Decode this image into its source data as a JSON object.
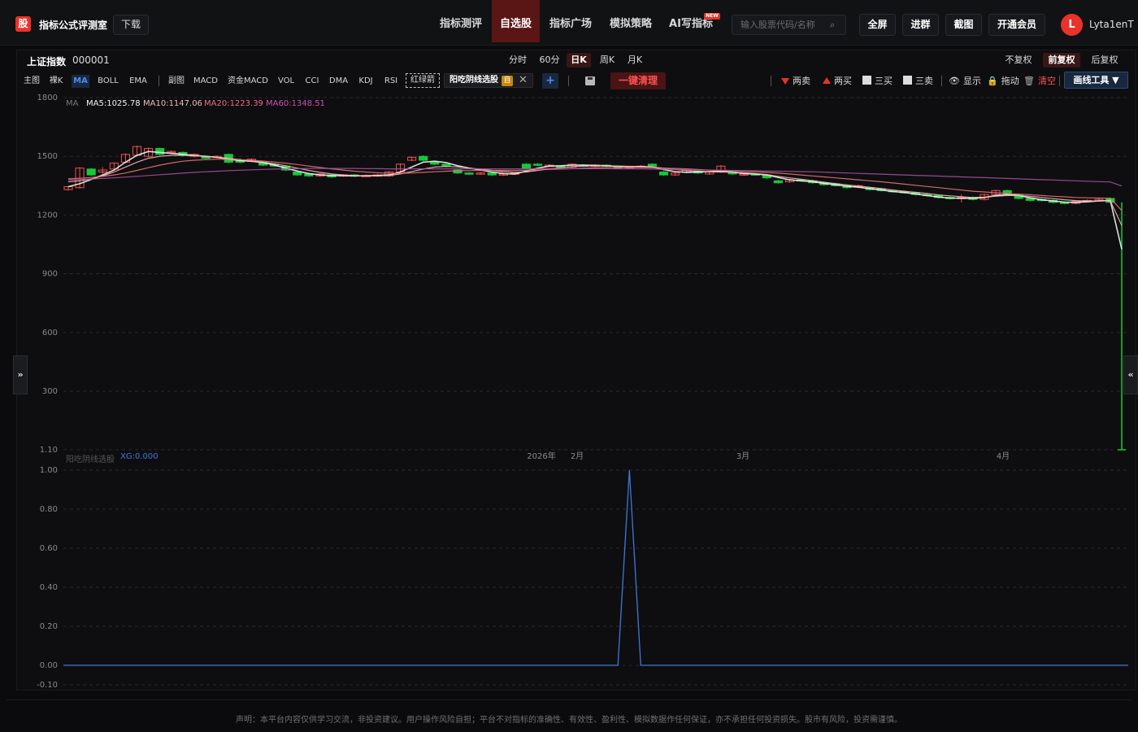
{
  "header": {
    "logo_glyph": "股",
    "app_title": "指标公式评测室",
    "download_label": "下载",
    "nav": [
      {
        "label": "指标测评"
      },
      {
        "label": "自选股"
      },
      {
        "label": "指标广场"
      },
      {
        "label": "模拟策略"
      },
      {
        "label": "AI写指标"
      }
    ],
    "new_badge": "NEW",
    "search_placeholder": "输入股票代码/名称",
    "buttons": {
      "fullscreen": "全屏",
      "join_group": "进群",
      "screenshot": "截图",
      "membership": "开通会员"
    },
    "avatar_letter": "L",
    "username": "Lyta1enT"
  },
  "stock": {
    "name": "上证指数",
    "code": "000001"
  },
  "periods": [
    "分时",
    "60分",
    "日K",
    "周K",
    "月K"
  ],
  "active_period": "日K",
  "adjustments": [
    "不复权",
    "前复权",
    "后复权"
  ],
  "active_adjustment": "前复权",
  "indicators": {
    "main": [
      "主图",
      "裸K",
      "MA",
      "BOLL",
      "EMA"
    ],
    "sub": [
      "副图",
      "MACD",
      "资金MACD",
      "VOL",
      "CCI",
      "DMA",
      "KDJ",
      "RSI"
    ],
    "red_green_arrow": "红绿箭",
    "custom_chip": "阳吃阴线选股",
    "custom_chip_tag": "自",
    "clear_all": "一键清理"
  },
  "tools": {
    "two_sell": "两卖",
    "two_buy": "两买",
    "three_buy": "三买",
    "three_sell": "三卖",
    "show": "显示",
    "drag": "拖动",
    "clear": "清空",
    "draw_tools": "画线工具 ▼"
  },
  "colors": {
    "accent_red": "#e8322b",
    "up_candle": "#ef4f4f",
    "down_candle": "#16c93a",
    "ma5": "#f2f2f2",
    "ma10": "#f3b7b7",
    "ma20": "#e57373",
    "ma60": "#a4519c",
    "sub_line": "#3d78d8"
  },
  "chart_data": {
    "type": "candlestick",
    "main": {
      "ma_legend": {
        "label": "MA",
        "ma5": "MA5:1025.78",
        "ma10": "MA10:1147.06",
        "ma20": "MA20:1223.39",
        "ma60": "MA60:1348.51"
      },
      "y_ticks": [
        "1800",
        "1500",
        "1200",
        "900",
        "600",
        "300",
        "1.10"
      ],
      "y_values": [
        1800,
        1500,
        1200,
        900,
        600,
        300,
        1.1
      ],
      "ylim": [
        1.1,
        1800
      ],
      "x_labels": [
        "2026年",
        "2月",
        "3月",
        "4月"
      ],
      "candles": [
        {
          "o": 1330,
          "c": 1345,
          "h": 1348,
          "l": 1325
        },
        {
          "o": 1340,
          "c": 1440,
          "h": 1445,
          "l": 1335
        },
        {
          "o": 1435,
          "c": 1405,
          "h": 1440,
          "l": 1400
        },
        {
          "o": 1420,
          "c": 1430,
          "h": 1445,
          "l": 1410
        },
        {
          "o": 1435,
          "c": 1465,
          "h": 1470,
          "l": 1430
        },
        {
          "o": 1470,
          "c": 1510,
          "h": 1515,
          "l": 1465
        },
        {
          "o": 1505,
          "c": 1550,
          "h": 1555,
          "l": 1500
        },
        {
          "o": 1500,
          "c": 1540,
          "h": 1545,
          "l": 1495
        },
        {
          "o": 1540,
          "c": 1510,
          "h": 1545,
          "l": 1505
        },
        {
          "o": 1520,
          "c": 1525,
          "h": 1530,
          "l": 1512
        },
        {
          "o": 1520,
          "c": 1505,
          "h": 1525,
          "l": 1500
        },
        {
          "o": 1500,
          "c": 1510,
          "h": 1515,
          "l": 1495
        },
        {
          "o": 1500,
          "c": 1490,
          "h": 1505,
          "l": 1485
        },
        {
          "o": 1495,
          "c": 1500,
          "h": 1505,
          "l": 1490
        },
        {
          "o": 1510,
          "c": 1470,
          "h": 1515,
          "l": 1465
        },
        {
          "o": 1480,
          "c": 1470,
          "h": 1490,
          "l": 1465
        },
        {
          "o": 1475,
          "c": 1485,
          "h": 1490,
          "l": 1470
        },
        {
          "o": 1470,
          "c": 1455,
          "h": 1475,
          "l": 1450
        },
        {
          "o": 1460,
          "c": 1450,
          "h": 1465,
          "l": 1445
        },
        {
          "o": 1450,
          "c": 1430,
          "h": 1455,
          "l": 1425
        },
        {
          "o": 1420,
          "c": 1405,
          "h": 1425,
          "l": 1400
        },
        {
          "o": 1410,
          "c": 1400,
          "h": 1415,
          "l": 1395
        },
        {
          "o": 1400,
          "c": 1410,
          "h": 1415,
          "l": 1395
        },
        {
          "o": 1405,
          "c": 1395,
          "h": 1410,
          "l": 1390
        },
        {
          "o": 1400,
          "c": 1405,
          "h": 1410,
          "l": 1395
        },
        {
          "o": 1405,
          "c": 1400,
          "h": 1410,
          "l": 1395
        },
        {
          "o": 1400,
          "c": 1402,
          "h": 1407,
          "l": 1395
        },
        {
          "o": 1400,
          "c": 1405,
          "h": 1410,
          "l": 1395
        },
        {
          "o": 1400,
          "c": 1420,
          "h": 1425,
          "l": 1395
        },
        {
          "o": 1420,
          "c": 1460,
          "h": 1465,
          "l": 1415
        },
        {
          "o": 1480,
          "c": 1495,
          "h": 1500,
          "l": 1475
        },
        {
          "o": 1500,
          "c": 1480,
          "h": 1505,
          "l": 1475
        },
        {
          "o": 1470,
          "c": 1460,
          "h": 1475,
          "l": 1455
        },
        {
          "o": 1460,
          "c": 1450,
          "h": 1465,
          "l": 1445
        },
        {
          "o": 1430,
          "c": 1415,
          "h": 1435,
          "l": 1410
        },
        {
          "o": 1415,
          "c": 1410,
          "h": 1420,
          "l": 1405
        },
        {
          "o": 1410,
          "c": 1415,
          "h": 1420,
          "l": 1405
        },
        {
          "o": 1415,
          "c": 1405,
          "h": 1420,
          "l": 1400
        },
        {
          "o": 1405,
          "c": 1410,
          "h": 1415,
          "l": 1400
        },
        {
          "o": 1410,
          "c": 1415,
          "h": 1420,
          "l": 1405
        },
        {
          "o": 1460,
          "c": 1440,
          "h": 1465,
          "l": 1435
        },
        {
          "o": 1460,
          "c": 1455,
          "h": 1465,
          "l": 1450
        },
        {
          "o": 1450,
          "c": 1455,
          "h": 1460,
          "l": 1445
        },
        {
          "o": 1450,
          "c": 1445,
          "h": 1455,
          "l": 1440
        },
        {
          "o": 1445,
          "c": 1460,
          "h": 1465,
          "l": 1440
        },
        {
          "o": 1455,
          "c": 1450,
          "h": 1460,
          "l": 1445
        },
        {
          "o": 1450,
          "c": 1455,
          "h": 1460,
          "l": 1445
        },
        {
          "o": 1455,
          "c": 1450,
          "h": 1460,
          "l": 1445
        },
        {
          "o": 1445,
          "c": 1440,
          "h": 1450,
          "l": 1435
        },
        {
          "o": 1440,
          "c": 1445,
          "h": 1450,
          "l": 1435
        },
        {
          "o": 1445,
          "c": 1450,
          "h": 1455,
          "l": 1440
        },
        {
          "o": 1460,
          "c": 1450,
          "h": 1465,
          "l": 1445
        },
        {
          "o": 1420,
          "c": 1405,
          "h": 1425,
          "l": 1400
        },
        {
          "o": 1405,
          "c": 1415,
          "h": 1420,
          "l": 1400
        },
        {
          "o": 1420,
          "c": 1430,
          "h": 1435,
          "l": 1415
        },
        {
          "o": 1425,
          "c": 1415,
          "h": 1430,
          "l": 1410
        },
        {
          "o": 1410,
          "c": 1420,
          "h": 1425,
          "l": 1405
        },
        {
          "o": 1420,
          "c": 1450,
          "h": 1455,
          "l": 1415
        },
        {
          "o": 1420,
          "c": 1410,
          "h": 1425,
          "l": 1405
        },
        {
          "o": 1405,
          "c": 1410,
          "h": 1415,
          "l": 1400
        },
        {
          "o": 1410,
          "c": 1405,
          "h": 1415,
          "l": 1400
        },
        {
          "o": 1405,
          "c": 1390,
          "h": 1410,
          "l": 1385
        },
        {
          "o": 1375,
          "c": 1365,
          "h": 1380,
          "l": 1360
        },
        {
          "o": 1370,
          "c": 1380,
          "h": 1385,
          "l": 1365
        },
        {
          "o": 1380,
          "c": 1375,
          "h": 1385,
          "l": 1370
        },
        {
          "o": 1375,
          "c": 1365,
          "h": 1380,
          "l": 1360
        },
        {
          "o": 1365,
          "c": 1355,
          "h": 1370,
          "l": 1350
        },
        {
          "o": 1360,
          "c": 1350,
          "h": 1365,
          "l": 1345
        },
        {
          "o": 1350,
          "c": 1340,
          "h": 1355,
          "l": 1335
        },
        {
          "o": 1345,
          "c": 1350,
          "h": 1355,
          "l": 1340
        },
        {
          "o": 1340,
          "c": 1330,
          "h": 1345,
          "l": 1325
        },
        {
          "o": 1335,
          "c": 1325,
          "h": 1340,
          "l": 1320
        },
        {
          "o": 1325,
          "c": 1320,
          "h": 1330,
          "l": 1315
        },
        {
          "o": 1320,
          "c": 1315,
          "h": 1325,
          "l": 1310
        },
        {
          "o": 1315,
          "c": 1305,
          "h": 1320,
          "l": 1300
        },
        {
          "o": 1305,
          "c": 1300,
          "h": 1310,
          "l": 1295
        },
        {
          "o": 1300,
          "c": 1290,
          "h": 1305,
          "l": 1285
        },
        {
          "o": 1290,
          "c": 1285,
          "h": 1295,
          "l": 1280
        },
        {
          "o": 1285,
          "c": 1290,
          "h": 1305,
          "l": 1265
        },
        {
          "o": 1290,
          "c": 1280,
          "h": 1295,
          "l": 1275
        },
        {
          "o": 1280,
          "c": 1305,
          "h": 1310,
          "l": 1275
        },
        {
          "o": 1305,
          "c": 1325,
          "h": 1330,
          "l": 1300
        },
        {
          "o": 1325,
          "c": 1310,
          "h": 1330,
          "l": 1305
        },
        {
          "o": 1305,
          "c": 1285,
          "h": 1310,
          "l": 1280
        },
        {
          "o": 1285,
          "c": 1275,
          "h": 1290,
          "l": 1270
        },
        {
          "o": 1280,
          "c": 1275,
          "h": 1285,
          "l": 1270
        },
        {
          "o": 1275,
          "c": 1265,
          "h": 1280,
          "l": 1260
        },
        {
          "o": 1265,
          "c": 1260,
          "h": 1270,
          "l": 1255
        },
        {
          "o": 1260,
          "c": 1270,
          "h": 1275,
          "l": 1255
        },
        {
          "o": 1270,
          "c": 1275,
          "h": 1280,
          "l": 1265
        },
        {
          "o": 1275,
          "c": 1280,
          "h": 1285,
          "l": 1270
        },
        {
          "o": 1285,
          "c": 1265,
          "h": 1290,
          "l": 1260
        },
        {
          "o": 1265,
          "c": 1.1,
          "h": 1265,
          "l": 1.1
        }
      ],
      "ma_series": [
        {
          "name": "MA5",
          "values": [
            1345,
            1360,
            1382,
            1405,
            1430,
            1470,
            1505,
            1525,
            1520,
            1515,
            1510,
            1505,
            1500,
            1495,
            1485,
            1478,
            1475,
            1468,
            1455,
            1440,
            1425,
            1412,
            1405,
            1402,
            1401,
            1400,
            1401,
            1402,
            1405,
            1420,
            1445,
            1470,
            1475,
            1468,
            1452,
            1440,
            1430,
            1420,
            1412,
            1410,
            1425,
            1440,
            1450,
            1452,
            1455,
            1455,
            1454,
            1452,
            1449,
            1447,
            1448,
            1445,
            1432,
            1422,
            1418,
            1420,
            1422,
            1425,
            1420,
            1412,
            1410,
            1405,
            1392,
            1380,
            1375,
            1370,
            1362,
            1355,
            1347,
            1342,
            1335,
            1328,
            1320,
            1315,
            1308,
            1300,
            1292,
            1287,
            1286,
            1285,
            1290,
            1300,
            1305,
            1300,
            1288,
            1278,
            1272,
            1266,
            1265,
            1268,
            1272,
            1275,
            1025.78
          ]
        },
        {
          "name": "MA10",
          "values": [
            1370,
            1375,
            1385,
            1400,
            1420,
            1445,
            1470,
            1490,
            1500,
            1505,
            1505,
            1503,
            1500,
            1495,
            1490,
            1483,
            1477,
            1470,
            1462,
            1452,
            1440,
            1428,
            1418,
            1410,
            1405,
            1402,
            1400,
            1400,
            1402,
            1410,
            1422,
            1435,
            1445,
            1448,
            1446,
            1440,
            1435,
            1428,
            1422,
            1418,
            1420,
            1428,
            1436,
            1442,
            1447,
            1450,
            1451,
            1451,
            1450,
            1449,
            1448,
            1446,
            1440,
            1433,
            1427,
            1424,
            1421,
            1420,
            1419,
            1416,
            1412,
            1407,
            1398,
            1390,
            1383,
            1376,
            1368,
            1361,
            1354,
            1348,
            1342,
            1335,
            1328,
            1322,
            1316,
            1310,
            1303,
            1298,
            1294,
            1290,
            1292,
            1296,
            1300,
            1300,
            1296,
            1290,
            1284,
            1278,
            1274,
            1272,
            1272,
            1273,
            1147.06
          ]
        },
        {
          "name": "MA20",
          "values": [
            1385,
            1388,
            1392,
            1398,
            1405,
            1415,
            1428,
            1442,
            1455,
            1466,
            1475,
            1480,
            1483,
            1485,
            1485,
            1483,
            1480,
            1476,
            1471,
            1465,
            1458,
            1450,
            1443,
            1436,
            1430,
            1424,
            1420,
            1416,
            1413,
            1413,
            1415,
            1418,
            1421,
            1424,
            1426,
            1427,
            1428,
            1428,
            1428,
            1428,
            1429,
            1431,
            1433,
            1435,
            1437,
            1439,
            1441,
            1442,
            1443,
            1443,
            1443,
            1442,
            1440,
            1438,
            1436,
            1433,
            1430,
            1428,
            1426,
            1424,
            1421,
            1418,
            1414,
            1410,
            1405,
            1400,
            1395,
            1390,
            1385,
            1380,
            1375,
            1370,
            1364,
            1358,
            1352,
            1346,
            1340,
            1334,
            1328,
            1322,
            1318,
            1314,
            1310,
            1307,
            1304,
            1300,
            1296,
            1293,
            1290,
            1288,
            1287,
            1286,
            1223.39
          ]
        },
        {
          "name": "MA60",
          "values": [
            1380,
            1382,
            1384,
            1387,
            1390,
            1394,
            1398,
            1402,
            1406,
            1410,
            1414,
            1418,
            1421,
            1424,
            1427,
            1429,
            1431,
            1433,
            1435,
            1436,
            1437,
            1438,
            1438,
            1438,
            1438,
            1438,
            1437,
            1437,
            1436,
            1436,
            1436,
            1436,
            1436,
            1436,
            1436,
            1436,
            1436,
            1436,
            1436,
            1436,
            1436,
            1437,
            1437,
            1437,
            1437,
            1437,
            1437,
            1437,
            1436,
            1436,
            1436,
            1435,
            1434,
            1433,
            1432,
            1431,
            1430,
            1429,
            1428,
            1427,
            1426,
            1425,
            1424,
            1423,
            1422,
            1421,
            1419,
            1417,
            1415,
            1413,
            1411,
            1409,
            1407,
            1405,
            1403,
            1401,
            1399,
            1397,
            1395,
            1393,
            1391,
            1389,
            1387,
            1385,
            1383,
            1381,
            1379,
            1377,
            1375,
            1373,
            1371,
            1369,
            1348.51
          ]
        }
      ]
    },
    "sub": {
      "indicator_name": "阳吃阴线选股",
      "value_label": "XG:0.000",
      "y_ticks": [
        "1.00",
        "0.80",
        "0.60",
        "0.40",
        "0.20",
        "0.00",
        "-0.10"
      ],
      "y_values": [
        1.0,
        0.8,
        0.6,
        0.4,
        0.2,
        0.0,
        -0.1
      ],
      "ylim": [
        -0.1,
        1.0
      ],
      "series": [
        {
          "name": "XG",
          "spike_index": 49,
          "spike_value": 1.0,
          "baseline": 0.0
        }
      ]
    }
  },
  "disclaimer": "声明：本平台内容仅供学习交流，非投资建议。用户操作风险自担；平台不对指标的准确性、有效性、盈利性、模拟数据作任何保证，亦不承担任何投资损失。股市有风险，投资需谨慎。",
  "side_toggles": {
    "left": "»",
    "right": "«"
  }
}
